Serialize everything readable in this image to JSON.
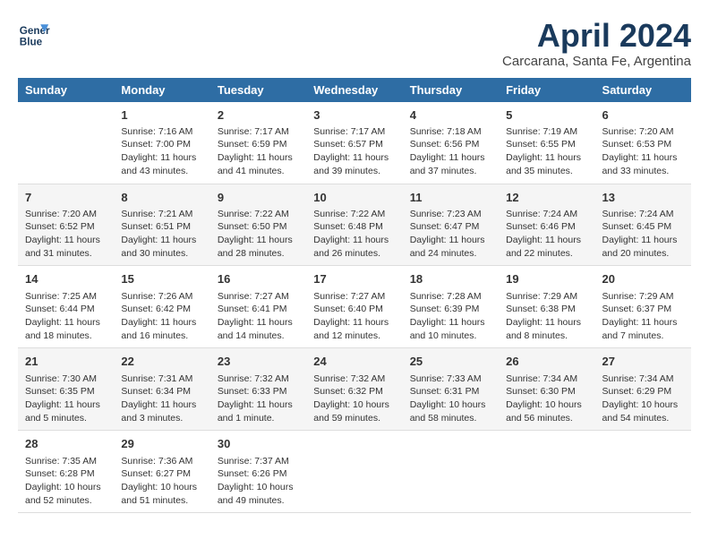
{
  "logo": {
    "line1": "General",
    "line2": "Blue"
  },
  "title": "April 2024",
  "subtitle": "Carcarana, Santa Fe, Argentina",
  "headers": [
    "Sunday",
    "Monday",
    "Tuesday",
    "Wednesday",
    "Thursday",
    "Friday",
    "Saturday"
  ],
  "weeks": [
    [
      {
        "day": "",
        "info": ""
      },
      {
        "day": "1",
        "info": "Sunrise: 7:16 AM\nSunset: 7:00 PM\nDaylight: 11 hours\nand 43 minutes."
      },
      {
        "day": "2",
        "info": "Sunrise: 7:17 AM\nSunset: 6:59 PM\nDaylight: 11 hours\nand 41 minutes."
      },
      {
        "day": "3",
        "info": "Sunrise: 7:17 AM\nSunset: 6:57 PM\nDaylight: 11 hours\nand 39 minutes."
      },
      {
        "day": "4",
        "info": "Sunrise: 7:18 AM\nSunset: 6:56 PM\nDaylight: 11 hours\nand 37 minutes."
      },
      {
        "day": "5",
        "info": "Sunrise: 7:19 AM\nSunset: 6:55 PM\nDaylight: 11 hours\nand 35 minutes."
      },
      {
        "day": "6",
        "info": "Sunrise: 7:20 AM\nSunset: 6:53 PM\nDaylight: 11 hours\nand 33 minutes."
      }
    ],
    [
      {
        "day": "7",
        "info": "Sunrise: 7:20 AM\nSunset: 6:52 PM\nDaylight: 11 hours\nand 31 minutes."
      },
      {
        "day": "8",
        "info": "Sunrise: 7:21 AM\nSunset: 6:51 PM\nDaylight: 11 hours\nand 30 minutes."
      },
      {
        "day": "9",
        "info": "Sunrise: 7:22 AM\nSunset: 6:50 PM\nDaylight: 11 hours\nand 28 minutes."
      },
      {
        "day": "10",
        "info": "Sunrise: 7:22 AM\nSunset: 6:48 PM\nDaylight: 11 hours\nand 26 minutes."
      },
      {
        "day": "11",
        "info": "Sunrise: 7:23 AM\nSunset: 6:47 PM\nDaylight: 11 hours\nand 24 minutes."
      },
      {
        "day": "12",
        "info": "Sunrise: 7:24 AM\nSunset: 6:46 PM\nDaylight: 11 hours\nand 22 minutes."
      },
      {
        "day": "13",
        "info": "Sunrise: 7:24 AM\nSunset: 6:45 PM\nDaylight: 11 hours\nand 20 minutes."
      }
    ],
    [
      {
        "day": "14",
        "info": "Sunrise: 7:25 AM\nSunset: 6:44 PM\nDaylight: 11 hours\nand 18 minutes."
      },
      {
        "day": "15",
        "info": "Sunrise: 7:26 AM\nSunset: 6:42 PM\nDaylight: 11 hours\nand 16 minutes."
      },
      {
        "day": "16",
        "info": "Sunrise: 7:27 AM\nSunset: 6:41 PM\nDaylight: 11 hours\nand 14 minutes."
      },
      {
        "day": "17",
        "info": "Sunrise: 7:27 AM\nSunset: 6:40 PM\nDaylight: 11 hours\nand 12 minutes."
      },
      {
        "day": "18",
        "info": "Sunrise: 7:28 AM\nSunset: 6:39 PM\nDaylight: 11 hours\nand 10 minutes."
      },
      {
        "day": "19",
        "info": "Sunrise: 7:29 AM\nSunset: 6:38 PM\nDaylight: 11 hours\nand 8 minutes."
      },
      {
        "day": "20",
        "info": "Sunrise: 7:29 AM\nSunset: 6:37 PM\nDaylight: 11 hours\nand 7 minutes."
      }
    ],
    [
      {
        "day": "21",
        "info": "Sunrise: 7:30 AM\nSunset: 6:35 PM\nDaylight: 11 hours\nand 5 minutes."
      },
      {
        "day": "22",
        "info": "Sunrise: 7:31 AM\nSunset: 6:34 PM\nDaylight: 11 hours\nand 3 minutes."
      },
      {
        "day": "23",
        "info": "Sunrise: 7:32 AM\nSunset: 6:33 PM\nDaylight: 11 hours\nand 1 minute."
      },
      {
        "day": "24",
        "info": "Sunrise: 7:32 AM\nSunset: 6:32 PM\nDaylight: 10 hours\nand 59 minutes."
      },
      {
        "day": "25",
        "info": "Sunrise: 7:33 AM\nSunset: 6:31 PM\nDaylight: 10 hours\nand 58 minutes."
      },
      {
        "day": "26",
        "info": "Sunrise: 7:34 AM\nSunset: 6:30 PM\nDaylight: 10 hours\nand 56 minutes."
      },
      {
        "day": "27",
        "info": "Sunrise: 7:34 AM\nSunset: 6:29 PM\nDaylight: 10 hours\nand 54 minutes."
      }
    ],
    [
      {
        "day": "28",
        "info": "Sunrise: 7:35 AM\nSunset: 6:28 PM\nDaylight: 10 hours\nand 52 minutes."
      },
      {
        "day": "29",
        "info": "Sunrise: 7:36 AM\nSunset: 6:27 PM\nDaylight: 10 hours\nand 51 minutes."
      },
      {
        "day": "30",
        "info": "Sunrise: 7:37 AM\nSunset: 6:26 PM\nDaylight: 10 hours\nand 49 minutes."
      },
      {
        "day": "",
        "info": ""
      },
      {
        "day": "",
        "info": ""
      },
      {
        "day": "",
        "info": ""
      },
      {
        "day": "",
        "info": ""
      }
    ]
  ]
}
